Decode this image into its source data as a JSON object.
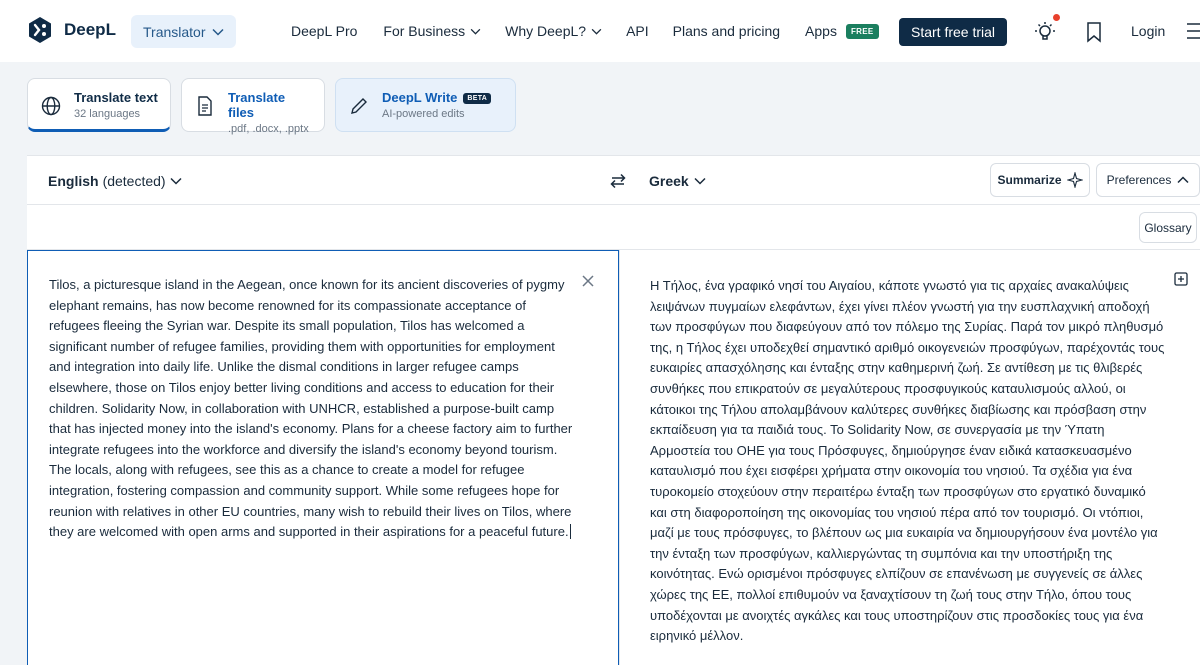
{
  "header": {
    "logo_text": "DeepL",
    "translator_label": "Translator",
    "nav": {
      "pro": "DeepL Pro",
      "business": "For Business",
      "why": "Why DeepL?",
      "api": "API",
      "pricing": "Plans and pricing",
      "apps": "Apps",
      "apps_badge": "FREE"
    },
    "trial_button": "Start free trial",
    "login": "Login"
  },
  "modes": {
    "translate_text": {
      "title": "Translate text",
      "subtitle": "32 languages"
    },
    "translate_files": {
      "title": "Translate files",
      "subtitle": ".pdf, .docx, .pptx"
    },
    "write": {
      "title": "DeepL Write",
      "badge": "BETA",
      "subtitle": "AI-powered edits"
    }
  },
  "translator": {
    "source_lang": "English",
    "source_detected": "(detected)",
    "target_lang": "Greek",
    "summarize": "Summarize",
    "preferences": "Preferences",
    "glossary": "Glossary",
    "source_text": "Tilos, a picturesque island in the Aegean, once known for its ancient discoveries of pygmy elephant remains, has now become renowned for its compassionate acceptance of refugees fleeing the Syrian war. Despite its small population, Tilos has welcomed a significant number of refugee families, providing them with opportunities for employment and integration into daily life. Unlike the dismal conditions in larger refugee camps elsewhere, those on Tilos enjoy better living conditions and access to education for their children. Solidarity Now, in collaboration with UNHCR, established a purpose-built camp that has injected money into the island's economy. Plans for a cheese factory aim to further integrate refugees into the workforce and diversify the island's economy beyond tourism. The locals, along with refugees, see this as a chance to create a model for refugee integration, fostering compassion and community support. While some refugees hope for reunion with relatives in other EU countries, many wish to rebuild their lives on Tilos, where they are welcomed with open arms and supported in their aspirations for a peaceful future.",
    "target_text": "Η Τήλος, ένα γραφικό νησί του Αιγαίου, κάποτε γνωστό για τις αρχαίες ανακαλύψεις λειψάνων πυγμαίων ελεφάντων, έχει γίνει πλέον γνωστή για την ευσπλαχνική αποδοχή των προσφύγων που διαφεύγουν από τον πόλεμο της Συρίας. Παρά τον μικρό πληθυσμό της, η Τήλος έχει υποδεχθεί σημαντικό αριθμό οικογενειών προσφύγων, παρέχοντάς τους ευκαιρίες απασχόλησης και ένταξης στην καθημερινή ζωή. Σε αντίθεση με τις θλιβερές συνθήκες που επικρατούν σε μεγαλύτερους προσφυγικούς καταυλισμούς αλλού, οι κάτοικοι της Τήλου απολαμβάνουν καλύτερες συνθήκες διαβίωσης και πρόσβαση στην εκπαίδευση για τα παιδιά τους. Το Solidarity Now, σε συνεργασία με την Ύπατη Αρμοστεία του ΟΗΕ για τους Πρόσφυγες, δημιούργησε έναν ειδικά κατασκευασμένο καταυλισμό που έχει εισφέρει χρήματα στην οικονομία του νησιού. Τα σχέδια για ένα τυροκομείο στοχεύουν στην περαιτέρω ένταξη των προσφύγων στο εργατικό δυναμικό και στη διαφοροποίηση της οικονομίας του νησιού πέρα από τον τουρισμό. Οι ντόπιοι, μαζί με τους πρόσφυγες, το βλέπουν ως μια ευκαιρία να δημιουργήσουν ένα μοντέλο για την ένταξη των προσφύγων, καλλιεργώντας τη συμπόνια και την υποστήριξη της κοινότητας. Ενώ ορισμένοι πρόσφυγες ελπίζουν σε επανένωση με συγγενείς σε άλλες χώρες της ΕΕ, πολλοί επιθυμούν να ξαναχτίσουν τη ζωή τους στην Τήλο, όπου τους υποδέχονται με ανοιχτές αγκάλες και τους υποστηρίζουν στις προσδοκίες τους για ένα ειρηνικό μέλλον."
  },
  "colors": {
    "brand_navy": "#0f2b46",
    "accent_blue": "#0f5db5",
    "free_badge_green": "#1b7f5f",
    "notification_red": "#e8402c"
  },
  "icons": [
    "deepl-logo-icon",
    "chevron-down-icon",
    "lightbulb-icon",
    "bookmark-icon",
    "menu-icon",
    "globe-icon",
    "document-icon",
    "pen-icon",
    "swap-icon",
    "sparkle-icon",
    "chevron-up-icon",
    "close-icon",
    "save-icon"
  ]
}
